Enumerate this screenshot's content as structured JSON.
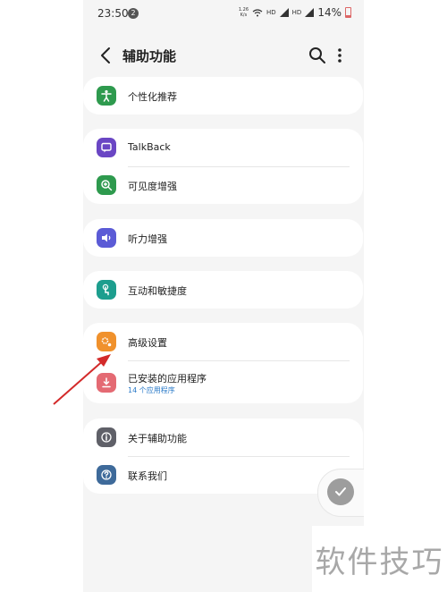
{
  "status": {
    "time": "23:50",
    "notification_count": "2",
    "net_speed_value": "1.26",
    "net_speed_unit": "K/s",
    "hd1": "HD",
    "hd2": "HD",
    "battery": "14%"
  },
  "header": {
    "title": "辅助功能"
  },
  "groups": [
    {
      "items": [
        {
          "label": "个性化推荐",
          "icon": "person-accessibility-icon",
          "color": "#2e9a4e"
        }
      ]
    },
    {
      "items": [
        {
          "label": "TalkBack",
          "icon": "chat-bubble-icon",
          "color": "#6a46c4"
        },
        {
          "label": "可见度增强",
          "icon": "magnifier-icon",
          "color": "#2e9a4e"
        }
      ]
    },
    {
      "items": [
        {
          "label": "听力增强",
          "icon": "speaker-icon",
          "color": "#5b5bd6"
        }
      ]
    },
    {
      "items": [
        {
          "label": "互动和敏捷度",
          "icon": "touch-hand-icon",
          "color": "#1d9e8e"
        }
      ]
    },
    {
      "items": [
        {
          "label": "高级设置",
          "icon": "gears-icon",
          "color": "#f0912c"
        },
        {
          "label": "已安装的应用程序",
          "sublabel": "14 个应用程序",
          "icon": "download-icon",
          "color": "#e46a73"
        }
      ]
    },
    {
      "items": [
        {
          "label": "关于辅助功能",
          "icon": "info-icon",
          "color": "#5f6068"
        },
        {
          "label": "联系我们",
          "icon": "question-icon",
          "color": "#3e6a9a"
        }
      ]
    }
  ],
  "watermark": "软件技巧"
}
